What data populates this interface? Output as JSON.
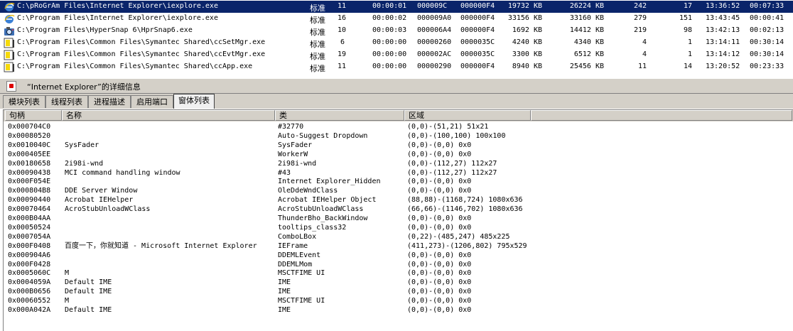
{
  "processes": [
    {
      "path": "C:\\pRoGrAm Files\\Internet Explorer\\iexplore.exe",
      "priority": "标准",
      "threads": "11",
      "cpu_time": "00:00:01",
      "pid": "000009C",
      "ppid": "000000F4",
      "mem": "19732 KB",
      "vmem": "26224 KB",
      "handles": "242",
      "gdi": "17",
      "start": "13:36:52",
      "elapsed": "00:07:33",
      "icon": "ie-icon",
      "selected": true
    },
    {
      "path": "C:\\Program Files\\Internet Explorer\\iexplore.exe",
      "priority": "标准",
      "threads": "16",
      "cpu_time": "00:00:02",
      "pid": "000009A0",
      "ppid": "000000F4",
      "mem": "33156 KB",
      "vmem": "33160 KB",
      "handles": "279",
      "gdi": "151",
      "start": "13:43:45",
      "elapsed": "00:00:41",
      "icon": "ie-icon",
      "selected": false
    },
    {
      "path": "C:\\Program Files\\HyperSnap 6\\HprSnap6.exe",
      "priority": "标准",
      "threads": "10",
      "cpu_time": "00:00:03",
      "pid": "000006A4",
      "ppid": "000000F4",
      "mem": "1692 KB",
      "vmem": "14412 KB",
      "handles": "219",
      "gdi": "98",
      "start": "13:42:13",
      "elapsed": "00:02:13",
      "icon": "hypersnap-icon",
      "selected": false
    },
    {
      "path": "C:\\Program Files\\Common Files\\Symantec Shared\\ccSetMgr.exe",
      "priority": "标准",
      "threads": "6",
      "cpu_time": "00:00:00",
      "pid": "00000260",
      "ppid": "0000035C",
      "mem": "4240 KB",
      "vmem": "4340 KB",
      "handles": "4",
      "gdi": "1",
      "start": "13:14:11",
      "elapsed": "00:30:14",
      "icon": "symantec-icon",
      "selected": false
    },
    {
      "path": "C:\\Program Files\\Common Files\\Symantec Shared\\ccEvtMgr.exe",
      "priority": "标准",
      "threads": "19",
      "cpu_time": "00:00:00",
      "pid": "000002AC",
      "ppid": "0000035C",
      "mem": "3300 KB",
      "vmem": "6512 KB",
      "handles": "4",
      "gdi": "1",
      "start": "13:14:12",
      "elapsed": "00:30:14",
      "icon": "symantec-icon",
      "selected": false
    },
    {
      "path": "C:\\Program Files\\Common Files\\Symantec Shared\\ccApp.exe",
      "priority": "标准",
      "threads": "11",
      "cpu_time": "00:00:00",
      "pid": "00000290",
      "ppid": "000000F4",
      "mem": "8940 KB",
      "vmem": "25456 KB",
      "handles": "11",
      "gdi": "14",
      "start": "13:20:52",
      "elapsed": "00:23:33",
      "icon": "symantec-icon",
      "selected": false
    }
  ],
  "info_bar": {
    "title": "“Internet Explorer”的详细信息"
  },
  "tabs": [
    "模块列表",
    "线程列表",
    "进程描述",
    "启用端口",
    "窗体列表"
  ],
  "active_tab": 4,
  "window_list": {
    "columns": [
      "句柄",
      "名称",
      "类",
      "区域"
    ],
    "rows": [
      [
        "0x000704C0",
        "",
        "#32770",
        "(0,0)-(51,21) 51x21"
      ],
      [
        "0x00080520",
        "",
        "Auto-Suggest Dropdown",
        "(0,0)-(100,100) 100x100"
      ],
      [
        "0x0010040C",
        "SysFader",
        "SysFader",
        "(0,0)-(0,0) 0x0"
      ],
      [
        "0x000405EE",
        "",
        "WorkerW",
        "(0,0)-(0,0) 0x0"
      ],
      [
        "0x00180658",
        "2i98i-wnd",
        "2i98i-wnd",
        "(0,0)-(112,27) 112x27"
      ],
      [
        "0x00090438",
        "MCI command handling window",
        "#43",
        "(0,0)-(112,27) 112x27"
      ],
      [
        "0x000F054E",
        "",
        "Internet Explorer_Hidden",
        "(0,0)-(0,0) 0x0"
      ],
      [
        "0x000804B8",
        "DDE Server Window",
        "OleDdeWndClass",
        "(0,0)-(0,0) 0x0"
      ],
      [
        "0x00090440",
        "Acrobat IEHelper",
        "Acrobat IEHelper Object",
        "(88,88)-(1168,724) 1080x636"
      ],
      [
        "0x00070464",
        "AcroStubUnloadWClass",
        "AcroStubUnloadWClass",
        "(66,66)-(1146,702) 1080x636"
      ],
      [
        "0x000B04AA",
        "",
        "ThunderBho_BackWindow",
        "(0,0)-(0,0) 0x0"
      ],
      [
        "0x00050524",
        "",
        "tooltips_class32",
        "(0,0)-(0,0) 0x0"
      ],
      [
        "0x0007054A",
        "",
        "ComboLBox",
        "(0,22)-(485,247) 485x225"
      ],
      [
        "0x000F0408",
        "百度一下，你就知道 - Microsoft Internet Explorer",
        "IEFrame",
        "(411,273)-(1206,802) 795x529"
      ],
      [
        "0x000904A6",
        "",
        "DDEMLEvent",
        "(0,0)-(0,0) 0x0"
      ],
      [
        "0x000F0428",
        "",
        "DDEMLMom",
        "(0,0)-(0,0) 0x0"
      ],
      [
        "0x0005060C",
        "M",
        "MSCTFIME UI",
        "(0,0)-(0,0) 0x0"
      ],
      [
        "0x0004059A",
        "Default IME",
        "IME",
        "(0,0)-(0,0) 0x0"
      ],
      [
        "0x000B0656",
        "Default IME",
        "IME",
        "(0,0)-(0,0) 0x0"
      ],
      [
        "0x00060552",
        "M",
        "MSCTFIME UI",
        "(0,0)-(0,0) 0x0"
      ],
      [
        "0x000A042A",
        "Default IME",
        "IME",
        "(0,0)-(0,0) 0x0"
      ]
    ]
  },
  "colors": {
    "selection": "#0a246a",
    "chrome": "#d4d0c8"
  }
}
